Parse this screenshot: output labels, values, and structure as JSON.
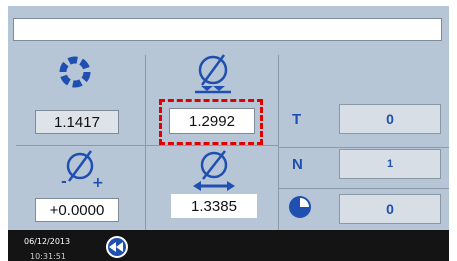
{
  "header": {
    "title_text": ""
  },
  "cells": {
    "outer_diameter_value": "1.1417",
    "bore_diameter_value": "1.2992",
    "tolerance_value": "+0.0000",
    "width_diameter_value": "1.3385"
  },
  "counters": {
    "t_label": "T",
    "t_value": "0",
    "n_label": "N",
    "n_value": "1",
    "clock_value": "0"
  },
  "footer": {
    "date": "06/12/2013",
    "time": "10:31:51"
  },
  "icons": {
    "ring": "ring-icon",
    "diameter_down": "diameter-inward-arrows-icon",
    "diameter_tolerance": "diameter-plus-minus-icon",
    "diameter_width": "diameter-double-arrow-icon",
    "clock": "clock-icon",
    "rewind": "rewind-icon"
  },
  "colors": {
    "panel": "#b7c6d6",
    "accent_blue": "#1f4fb0",
    "focus_red": "#e00000",
    "footer": "#141414"
  }
}
